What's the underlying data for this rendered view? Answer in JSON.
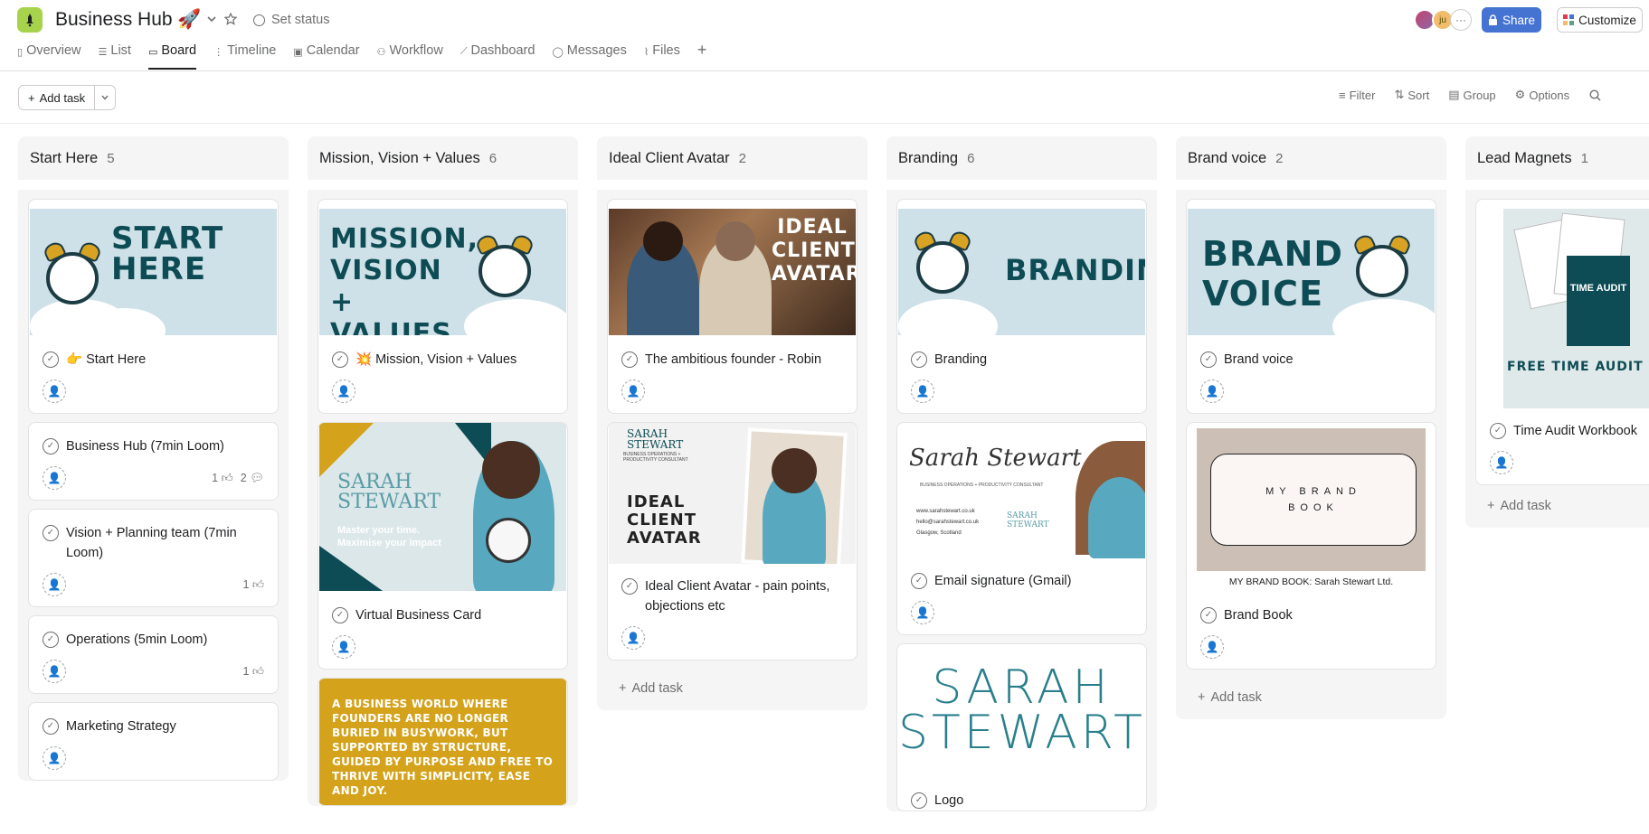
{
  "header": {
    "title": "Business Hub 🚀",
    "set_status": "Set status",
    "avatar_initials": "ju",
    "avatar_more": "···",
    "share": "Share",
    "customize": "Customize"
  },
  "tabs": [
    {
      "label": "Overview",
      "icon": "overview-icon"
    },
    {
      "label": "List",
      "icon": "list-icon"
    },
    {
      "label": "Board",
      "icon": "board-icon",
      "active": true
    },
    {
      "label": "Timeline",
      "icon": "timeline-icon"
    },
    {
      "label": "Calendar",
      "icon": "calendar-icon"
    },
    {
      "label": "Workflow",
      "icon": "workflow-icon"
    },
    {
      "label": "Dashboard",
      "icon": "dashboard-icon"
    },
    {
      "label": "Messages",
      "icon": "messages-icon"
    },
    {
      "label": "Files",
      "icon": "files-icon"
    }
  ],
  "toolbar": {
    "add_task": "Add task",
    "filter": "Filter",
    "sort": "Sort",
    "group": "Group",
    "options": "Options"
  },
  "columns": [
    {
      "name": "Start Here",
      "count": "5",
      "cards": [
        {
          "title": "👉 Start Here",
          "image_text": "START HERE"
        },
        {
          "title": "Business Hub (7min Loom)",
          "likes": "1",
          "comments": "2"
        },
        {
          "title": "Vision + Planning team (7min Loom)",
          "likes": "1"
        },
        {
          "title": "Operations (5min Loom)",
          "likes": "1"
        },
        {
          "title": "Marketing Strategy"
        }
      ]
    },
    {
      "name": "Mission, Vision + Values",
      "count": "6",
      "cards": [
        {
          "title": "💥 Mission, Vision + Values",
          "image_text": "MISSION, VISION + VALUES"
        },
        {
          "title": "Virtual Business Card",
          "image_brand": "SARAH STEWART",
          "image_tagline": "Master your time. Maximise your impact"
        },
        {
          "image_quote": "A BUSINESS WORLD WHERE FOUNDERS ARE NO LONGER BURIED IN BUSYWORK, BUT SUPPORTED BY STRUCTURE, GUIDED BY PURPOSE AND FREE TO THRIVE WITH SIMPLICITY, EASE AND JOY."
        }
      ]
    },
    {
      "name": "Ideal Client Avatar",
      "count": "2",
      "cards": [
        {
          "title": "The ambitious founder - Robin",
          "image_text": "IDEAL CLIENT AVATAR"
        },
        {
          "title": "Ideal Client Avatar - pain points, objections etc",
          "image_text": "IDEAL CLIENT AVATAR",
          "image_brand": "SARAH STEWART",
          "image_subtitle": "BUSINESS OPERATIONS + PRODUCTIVITY CONSULTANT"
        }
      ],
      "add_task": "Add task"
    },
    {
      "name": "Branding",
      "count": "6",
      "cards": [
        {
          "title": "Branding",
          "image_text": "BRANDING"
        },
        {
          "title": "Email signature (Gmail)",
          "image_signature": "Sarah Stewart",
          "image_subtitle": "BUSINESS OPERATIONS + PRODUCTIVITY CONSULTANT",
          "image_lines": [
            "www.sarahstewart.co.uk",
            "hello@sarahstewart.co.uk",
            "Glasgow, Scotland"
          ],
          "image_brand": "SARAH STEWART"
        },
        {
          "title": "Logo",
          "image_logo_1": "SARAH",
          "image_logo_2": "STEWART"
        }
      ]
    },
    {
      "name": "Brand voice",
      "count": "2",
      "cards": [
        {
          "title": "Brand voice",
          "image_text": "BRAND VOICE"
        },
        {
          "title": "Brand Book",
          "image_text": "MY BRAND BOOK",
          "image_caption": "MY BRAND BOOK: Sarah Stewart Ltd."
        }
      ],
      "add_task": "Add task"
    },
    {
      "name": "Lead Magnets",
      "count": "1",
      "cards": [
        {
          "title": "Time Audit Workbook",
          "image_text": "FREE TIME AUDIT WOR",
          "image_cover": "TIME AUDIT"
        }
      ],
      "add_task": "Add task"
    }
  ],
  "colors": {
    "accent": "#4573d2",
    "app_icon": "#a7d34c",
    "column_bg": "#f5f5f5",
    "brand_teal": "#0e4c55",
    "brand_gold": "#d4a21b"
  }
}
